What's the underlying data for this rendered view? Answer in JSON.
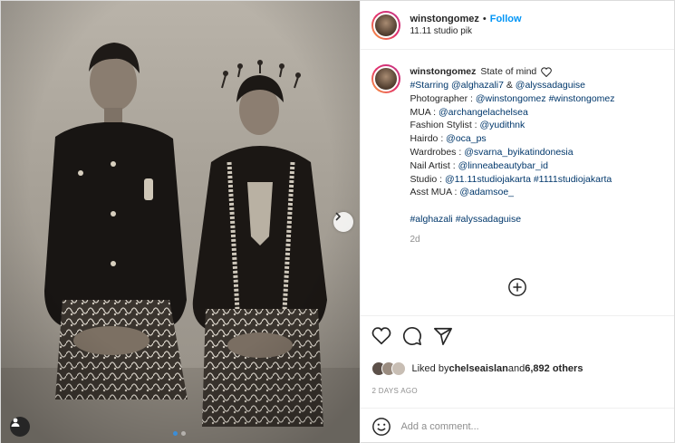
{
  "post": {
    "username": "winstongomez",
    "separator": "•",
    "follow_label": "Follow",
    "location": "11.11 studio pik"
  },
  "caption": {
    "username": "winstongomez",
    "first_text": "State of mind",
    "lines": [
      [
        {
          "t": "#Starring ",
          "link": true
        },
        {
          "t": "@alghazali7",
          "link": true
        },
        {
          "t": " & ",
          "link": false
        },
        {
          "t": "@alyssadaguise",
          "link": true
        }
      ],
      [
        {
          "t": "Photographer : ",
          "link": false
        },
        {
          "t": "@winstongomez",
          "link": true
        },
        {
          "t": " ",
          "link": false
        },
        {
          "t": "#winstongomez",
          "link": true
        }
      ],
      [
        {
          "t": "MUA : ",
          "link": false
        },
        {
          "t": "@archangelachelsea",
          "link": true
        }
      ],
      [
        {
          "t": "Fashion Stylist : ",
          "link": false
        },
        {
          "t": "@yudithnk",
          "link": true
        }
      ],
      [
        {
          "t": "Hairdo : ",
          "link": false
        },
        {
          "t": "@oca_ps",
          "link": true
        }
      ],
      [
        {
          "t": "Wardrobes : ",
          "link": false
        },
        {
          "t": "@svarna_byikatindonesia",
          "link": true
        }
      ],
      [
        {
          "t": "Nail Artist : ",
          "link": false
        },
        {
          "t": "@linneabeautybar_id",
          "link": true
        }
      ],
      [
        {
          "t": "Studio : ",
          "link": false
        },
        {
          "t": "@11.11studiojakarta",
          "link": true
        },
        {
          "t": " ",
          "link": false
        },
        {
          "t": "#1111studiojakarta",
          "link": true
        }
      ],
      [
        {
          "t": "Asst MUA : ",
          "link": false
        },
        {
          "t": "@adamsoe_",
          "link": true
        }
      ],
      [],
      [
        {
          "t": "#alghazali",
          "link": true
        },
        {
          "t": " ",
          "link": false
        },
        {
          "t": "#alyssadaguise",
          "link": true
        }
      ]
    ],
    "time": "2d"
  },
  "likes": {
    "prefix": "Liked by ",
    "user": "chelseaislan",
    "middle": " and ",
    "count": "6,892 others"
  },
  "time_ago": "2 DAYS AGO",
  "comment_box": {
    "placeholder": "Add a comment..."
  },
  "icons": [
    "heart-icon",
    "comment-icon",
    "share-icon",
    "add-icon",
    "emoji-icon",
    "chevron-right-icon",
    "user-tag-icon"
  ],
  "colors": {
    "link": "#00376b",
    "follow": "#0095f6",
    "muted": "#8e8e8e",
    "active_dot": "#3b8ed8"
  },
  "carousel": {
    "total": 2,
    "active": 1
  }
}
